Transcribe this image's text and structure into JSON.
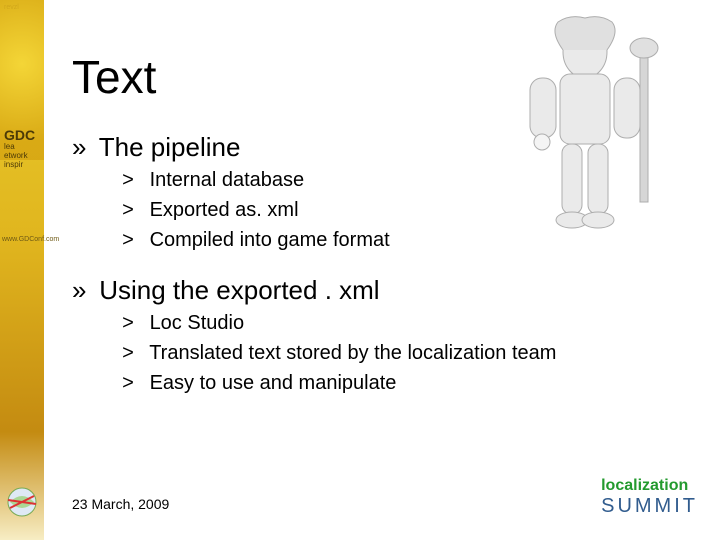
{
  "title": "Text",
  "sections": [
    {
      "heading": "The pipeline",
      "items": [
        "Internal database",
        "Exported as. xml",
        "Compiled into game format"
      ]
    },
    {
      "heading": "Using the exported . xml",
      "items": [
        "Loc Studio",
        "Translated text stored by the localization team",
        "Easy to use and manipulate"
      ]
    }
  ],
  "footer": {
    "date": "23 March, 2009",
    "logo_word1": "localization",
    "logo_word2": "SUMMIT"
  },
  "sidebar": {
    "top_tag": "revzl",
    "badge_line1": "GDC",
    "badge_line2": "lea",
    "badge_line3": "etwork",
    "badge_line4": "inspir",
    "url": "www.GDConf.com"
  },
  "bullets": {
    "l1": "»",
    "l2": ">"
  }
}
